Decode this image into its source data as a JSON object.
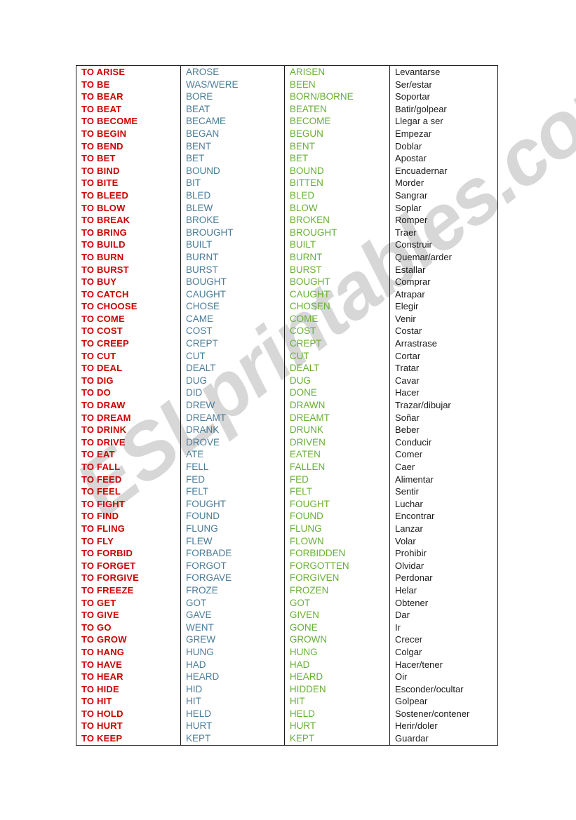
{
  "watermark": {
    "text": "ESLprintables.com"
  },
  "colors": {
    "infinitive": "#cc0000",
    "past_simple": "#4a7c99",
    "past_participle": "#66b032",
    "translation": "#1a1a1a",
    "border": "#1a1a1a",
    "watermark": "#c9c9c9"
  },
  "table": {
    "columns": [
      "infinitive",
      "past_simple",
      "past_participle",
      "translation"
    ],
    "rows": [
      [
        "TO ARISE",
        "AROSE",
        "ARISEN",
        "Levantarse"
      ],
      [
        "TO BE",
        "WAS/WERE",
        "BEEN",
        "Ser/estar"
      ],
      [
        "TO BEAR",
        "BORE",
        "BORN/BORNE",
        "Soportar"
      ],
      [
        "TO BEAT",
        "BEAT",
        "BEATEN",
        "Batir/golpear"
      ],
      [
        "TO BECOME",
        "BECAME",
        "BECOME",
        "Llegar a ser"
      ],
      [
        "TO BEGIN",
        "BEGAN",
        "BEGUN",
        "Empezar"
      ],
      [
        "TO BEND",
        "BENT",
        "BENT",
        "Doblar"
      ],
      [
        "TO BET",
        "BET",
        "BET",
        "Apostar"
      ],
      [
        "TO BIND",
        "BOUND",
        "BOUND",
        "Encuadernar"
      ],
      [
        "TO BITE",
        "BIT",
        "BITTEN",
        "Morder"
      ],
      [
        "TO BLEED",
        "BLED",
        "BLED",
        "Sangrar"
      ],
      [
        "TO BLOW",
        "BLEW",
        "BLOW",
        "Soplar"
      ],
      [
        "TO BREAK",
        "BROKE",
        "BROKEN",
        "Romper"
      ],
      [
        "TO BRING",
        "BROUGHT",
        "BROUGHT",
        "Traer"
      ],
      [
        "TO BUILD",
        "BUILT",
        "BUILT",
        "Construir"
      ],
      [
        "TO BURN",
        "BURNT",
        "BURNT",
        "Quemar/arder"
      ],
      [
        "TO BURST",
        "BURST",
        "BURST",
        "Estallar"
      ],
      [
        "TO BUY",
        "BOUGHT",
        "BOUGHT",
        "Comprar"
      ],
      [
        "TO CATCH",
        "CAUGHT",
        "CAUGHT",
        "Atrapar"
      ],
      [
        "TO CHOOSE",
        "CHOSE",
        "CHOSEN",
        "Elegir"
      ],
      [
        "TO COME",
        "CAME",
        "COME",
        "Venir"
      ],
      [
        "TO COST",
        "COST",
        "COST",
        "Costar"
      ],
      [
        "TO CREEP",
        "CREPT",
        "CREPT",
        "Arrastrase"
      ],
      [
        "TO CUT",
        "CUT",
        "CUT",
        "Cortar"
      ],
      [
        "TO DEAL",
        "DEALT",
        "DEALT",
        "Tratar"
      ],
      [
        "TO DIG",
        "DUG",
        "DUG",
        "Cavar"
      ],
      [
        "TO DO",
        "DID",
        "DONE",
        "Hacer"
      ],
      [
        "TO DRAW",
        "DREW",
        "DRAWN",
        "Trazar/dibujar"
      ],
      [
        "TO DREAM",
        "DREAMT",
        "DREAMT",
        "Soñar"
      ],
      [
        "TO DRINK",
        "DRANK",
        "DRUNK",
        "Beber"
      ],
      [
        "TO DRIVE",
        "DROVE",
        "DRIVEN",
        "Conducir"
      ],
      [
        "TO EAT",
        "ATE",
        "EATEN",
        "Comer"
      ],
      [
        "TO FALL",
        "FELL",
        "FALLEN",
        "Caer"
      ],
      [
        "TO FEED",
        "FED",
        "FED",
        "Alimentar"
      ],
      [
        "TO FEEL",
        "FELT",
        "FELT",
        "Sentir"
      ],
      [
        "TO FIGHT",
        "FOUGHT",
        "FOUGHT",
        "Luchar"
      ],
      [
        "TO FIND",
        "FOUND",
        "FOUND",
        "Encontrar"
      ],
      [
        "TO FLING",
        "FLUNG",
        "FLUNG",
        "Lanzar"
      ],
      [
        "TO FLY",
        "FLEW",
        "FLOWN",
        "Volar"
      ],
      [
        "TO FORBID",
        "FORBADE",
        "FORBIDDEN",
        "Prohibir"
      ],
      [
        "TO FORGET",
        "FORGOT",
        "FORGOTTEN",
        "Olvidar"
      ],
      [
        "TO FORGIVE",
        "FORGAVE",
        "FORGIVEN",
        "Perdonar"
      ],
      [
        "TO FREEZE",
        "FROZE",
        "FROZEN",
        "Helar"
      ],
      [
        "TO GET",
        "GOT",
        "GOT",
        "Obtener"
      ],
      [
        "TO GIVE",
        "GAVE",
        "GIVEN",
        "Dar"
      ],
      [
        "TO GO",
        "WENT",
        "GONE",
        "Ir"
      ],
      [
        "TO GROW",
        "GREW",
        "GROWN",
        "Crecer"
      ],
      [
        "TO HANG",
        "HUNG",
        "HUNG",
        "Colgar"
      ],
      [
        "TO HAVE",
        "HAD",
        "HAD",
        "Hacer/tener"
      ],
      [
        "TO HEAR",
        "HEARD",
        "HEARD",
        "Oir"
      ],
      [
        "TO HIDE",
        "HID",
        "HIDDEN",
        "Esconder/ocultar"
      ],
      [
        "TO HIT",
        "HIT",
        "HIT",
        "Golpear"
      ],
      [
        "TO HOLD",
        "HELD",
        "HELD",
        "Sostener/contener"
      ],
      [
        "TO HURT",
        "HURT",
        "HURT",
        "Herir/doler"
      ],
      [
        "TO KEEP",
        "KEPT",
        "KEPT",
        "Guardar"
      ]
    ]
  }
}
